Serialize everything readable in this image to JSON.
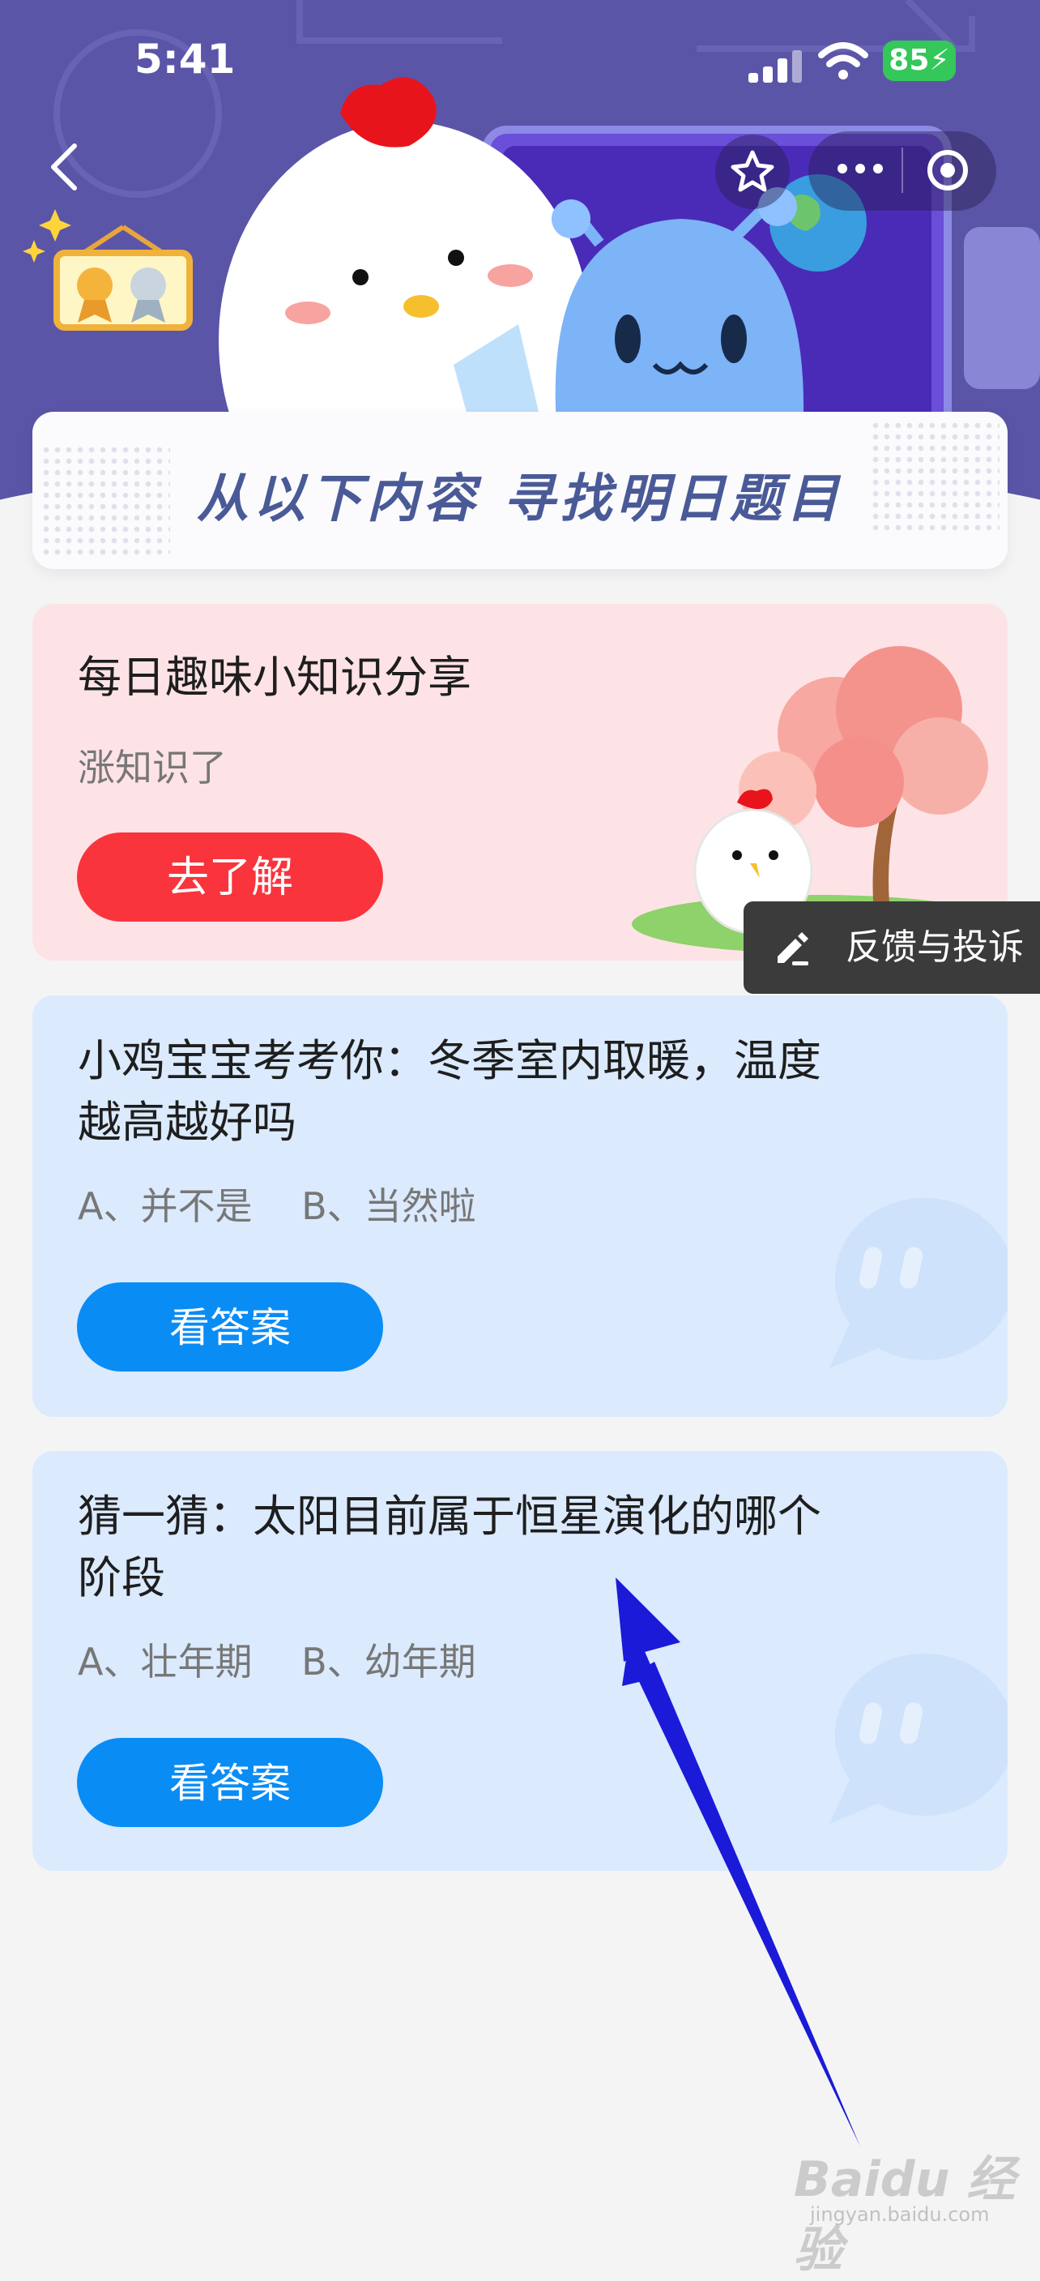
{
  "status_bar": {
    "time": "5:41",
    "battery": "85"
  },
  "banner": {
    "title": "从以下内容 寻找明日题目"
  },
  "cards": [
    {
      "title": "每日趣味小知识分享",
      "subtitle": "涨知识了",
      "button": "去了解"
    },
    {
      "title_line1": "小鸡宝宝考考你：冬季室内取暖，温度",
      "title_line2": "越高越好吗",
      "options": "A、并不是　 B、当然啦",
      "button": "看答案"
    },
    {
      "title_line1": "猜一猜：太阳目前属于恒星演化的哪个",
      "title_line2": "阶段",
      "options": "A、壮年期　 B、幼年期",
      "button": "看答案"
    }
  ],
  "feedback": {
    "label": "反馈与投诉"
  },
  "watermark": {
    "text": "Baidu 经验",
    "url": "jingyan.baidu.com"
  },
  "colors": {
    "header": "#5b55a8",
    "pink_card": "#fde3e6",
    "blue_card": "#dbeafd",
    "red_button": "#f9343d",
    "blue_button": "#0a8cf5",
    "annotation_arrow": "#1a1ad8"
  }
}
